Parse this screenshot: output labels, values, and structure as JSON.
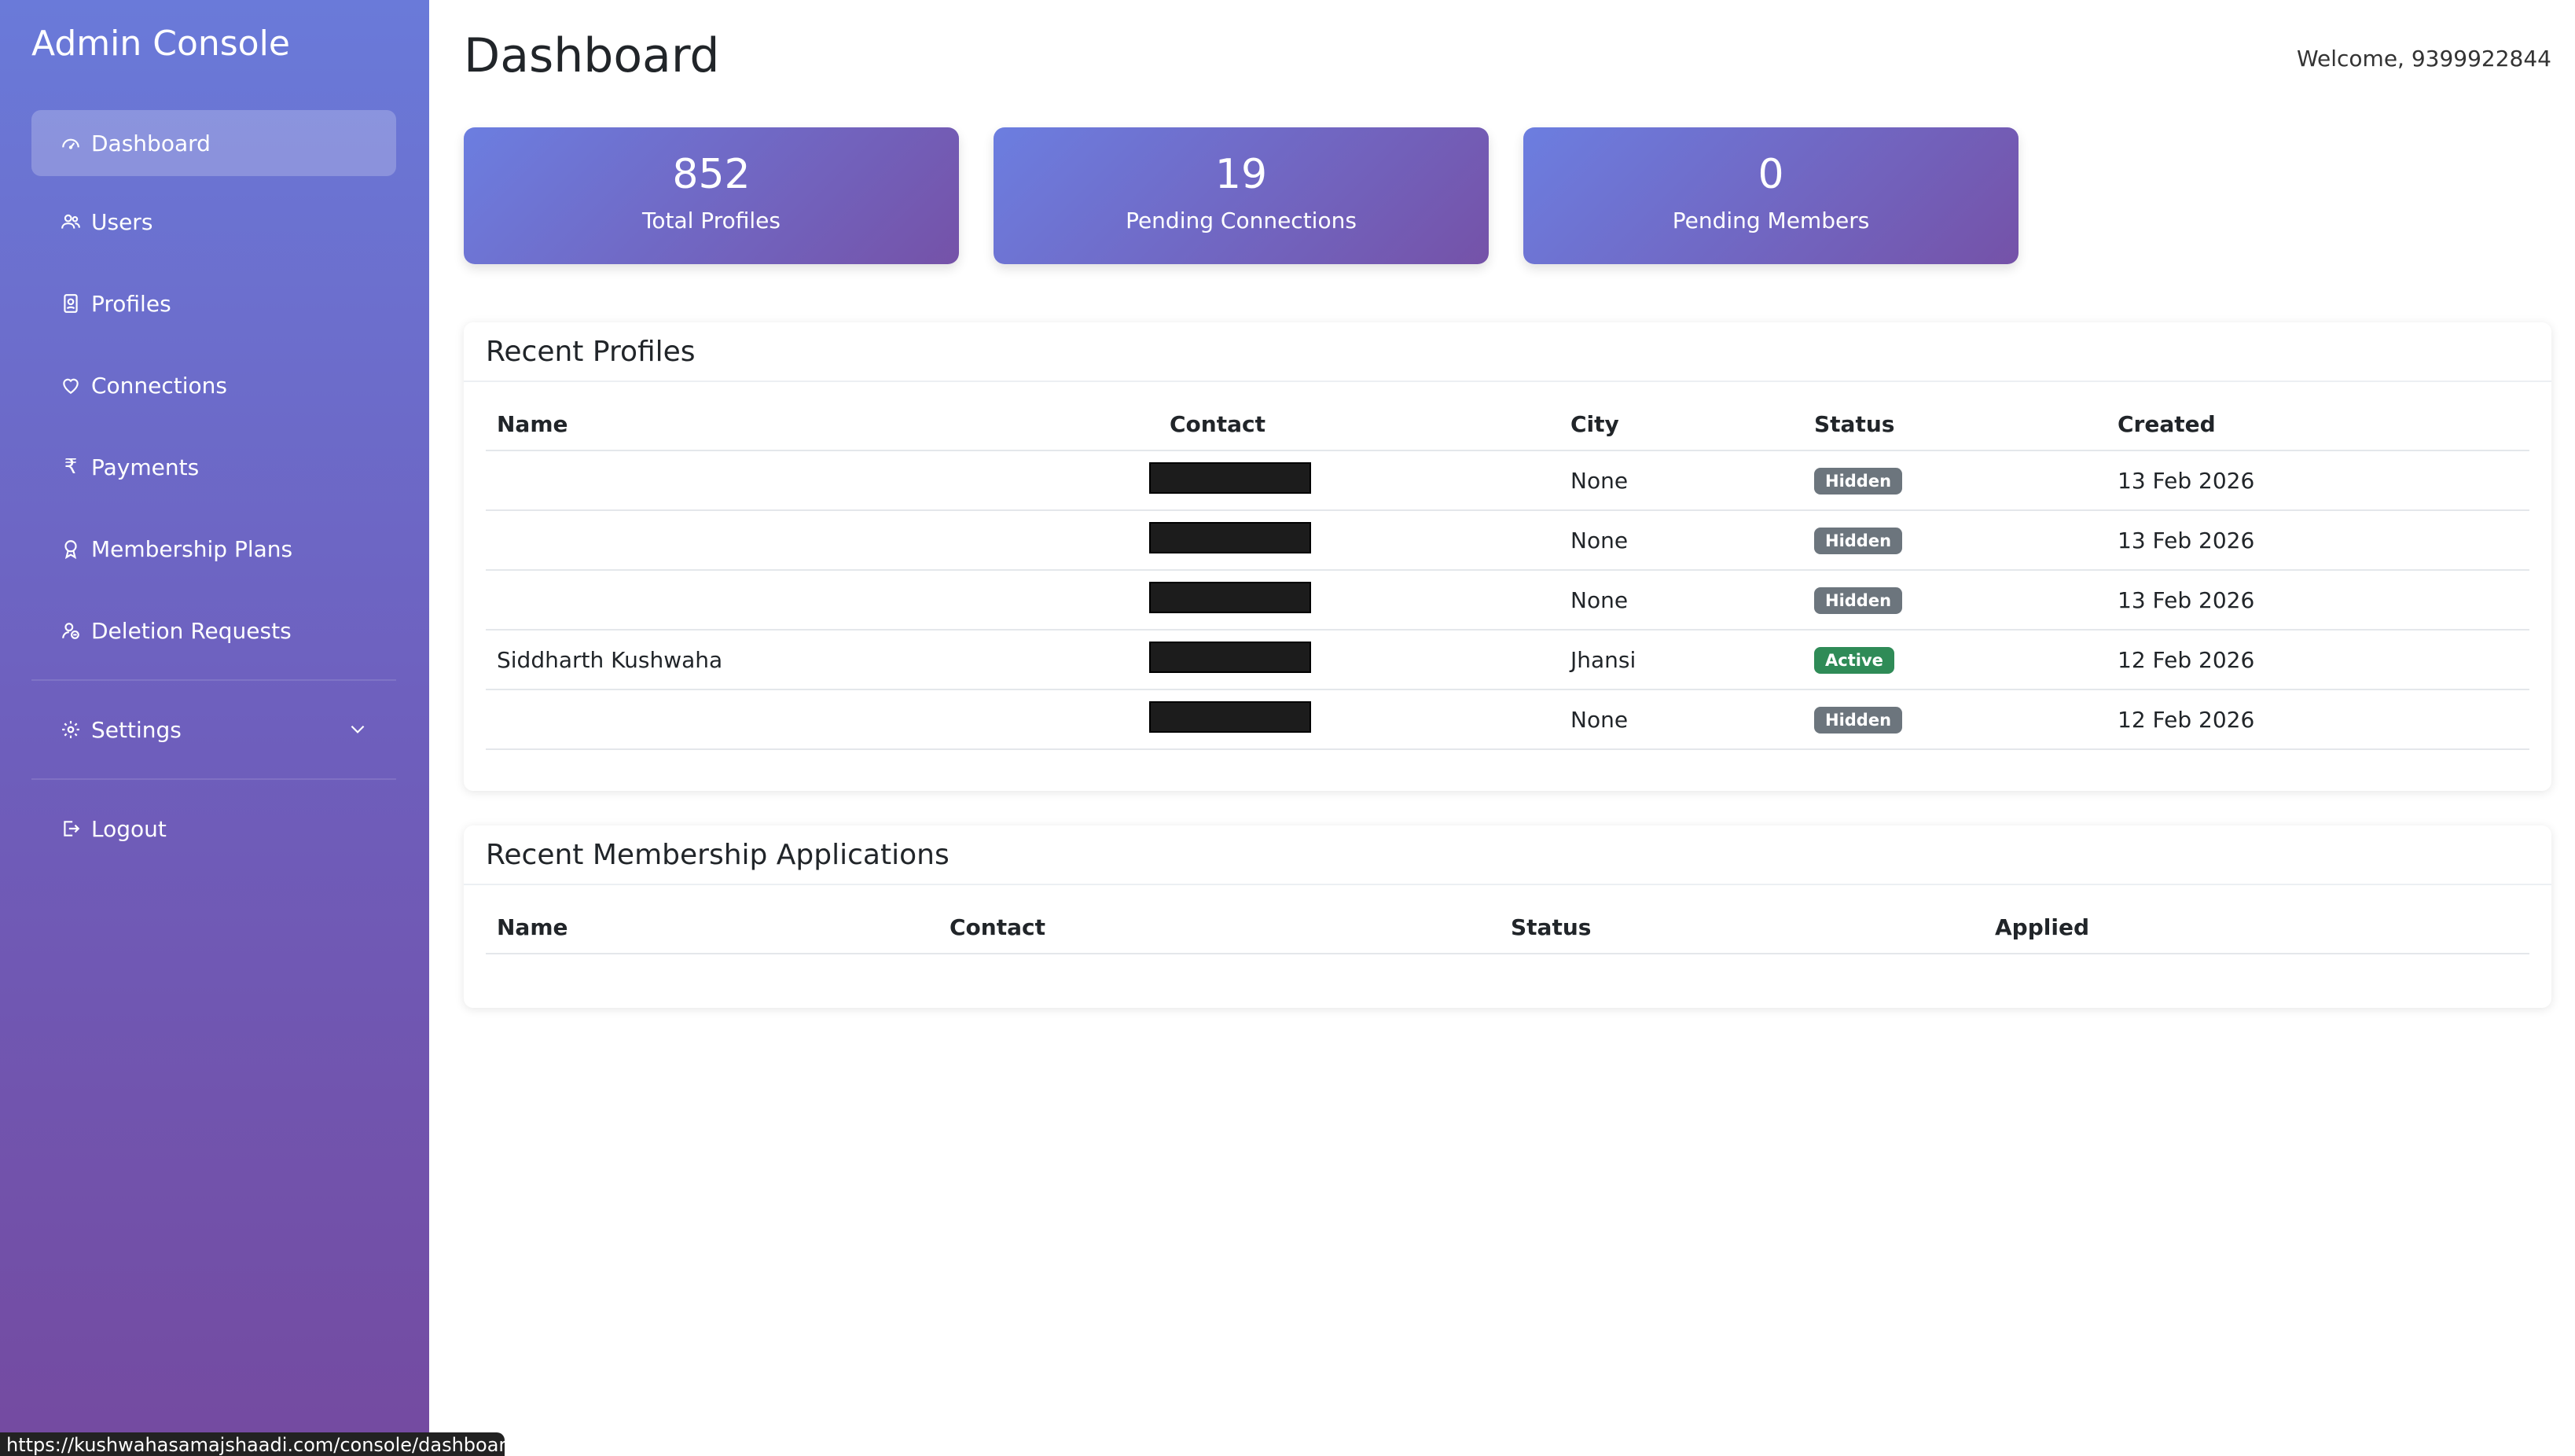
{
  "sidebar": {
    "brand": "Admin Console",
    "items": [
      {
        "label": "Dashboard",
        "icon": "dashboard-icon"
      },
      {
        "label": "Users",
        "icon": "users-icon"
      },
      {
        "label": "Profiles",
        "icon": "profile-card-icon"
      },
      {
        "label": "Connections",
        "icon": "heart-icon"
      },
      {
        "label": "Payments",
        "icon": "rupee-icon"
      },
      {
        "label": "Membership Plans",
        "icon": "award-icon"
      },
      {
        "label": "Deletion Requests",
        "icon": "user-remove-icon"
      }
    ],
    "settings": {
      "label": "Settings",
      "icon": "gear-icon"
    },
    "logout": {
      "label": "Logout",
      "icon": "logout-icon"
    }
  },
  "header": {
    "title": "Dashboard",
    "welcome": "Welcome, 9399922844"
  },
  "stats": [
    {
      "value": "852",
      "label": "Total Profiles"
    },
    {
      "value": "19",
      "label": "Pending Connections"
    },
    {
      "value": "0",
      "label": "Pending Members"
    }
  ],
  "recent_profiles": {
    "title": "Recent Profiles",
    "columns": [
      "Name",
      "Contact",
      "City",
      "Status",
      "Created"
    ],
    "rows": [
      {
        "name": "",
        "contact": "[redacted]",
        "city": "None",
        "status": "Hidden",
        "created": "13 Feb 2026"
      },
      {
        "name": "",
        "contact": "[redacted]",
        "city": "None",
        "status": "Hidden",
        "created": "13 Feb 2026"
      },
      {
        "name": "",
        "contact": "[redacted]",
        "city": "None",
        "status": "Hidden",
        "created": "13 Feb 2026"
      },
      {
        "name": "Siddharth Kushwaha",
        "contact": "[redacted]",
        "city": "Jhansi",
        "status": "Active",
        "created": "12 Feb 2026"
      },
      {
        "name": "",
        "contact": "[redacted]",
        "city": "None",
        "status": "Hidden",
        "created": "12 Feb 2026"
      }
    ]
  },
  "recent_memberships": {
    "title": "Recent Membership Applications",
    "columns": [
      "Name",
      "Contact",
      "Status",
      "Applied"
    ]
  },
  "status_url": "https://kushwahasamajshaadi.com/console/dashboard/",
  "colors": {
    "sidebar_top": "#6a7ad9",
    "sidebar_bottom": "#744aa0",
    "badge_hidden": "#6c757d",
    "badge_active": "#2f8b57"
  }
}
